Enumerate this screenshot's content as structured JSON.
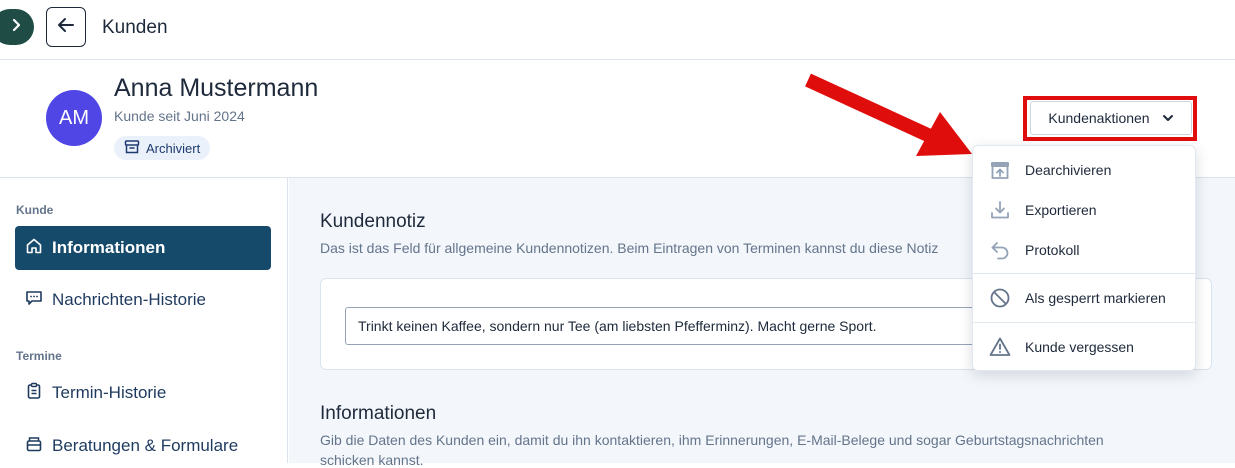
{
  "topbar": {
    "title": "Kunden",
    "expand_glyph": "›"
  },
  "customer": {
    "initials": "AM",
    "name": "Anna Mustermann",
    "since": "Kunde seit Juni 2024",
    "status_badge": "Archiviert"
  },
  "actions": {
    "button_label": "Kundenaktionen",
    "menu": [
      {
        "label": "Dearchivieren",
        "icon": "unarchive-icon"
      },
      {
        "label": "Exportieren",
        "icon": "download-icon"
      },
      {
        "label": "Protokoll",
        "icon": "undo-icon"
      },
      {
        "label": "Als gesperrt markieren",
        "icon": "block-icon"
      },
      {
        "label": "Kunde vergessen",
        "icon": "warning-icon"
      }
    ]
  },
  "sidebar": {
    "sections": [
      {
        "label": "Kunde",
        "items": [
          {
            "label": "Informationen",
            "icon": "home-icon",
            "active": true
          },
          {
            "label": "Nachrichten-Historie",
            "icon": "chat-icon"
          }
        ]
      },
      {
        "label": "Termine",
        "items": [
          {
            "label": "Termin-Historie",
            "icon": "clipboard-icon"
          },
          {
            "label": "Beratungen & Formulare",
            "icon": "forms-icon"
          }
        ]
      }
    ]
  },
  "main": {
    "note_title": "Kundennotiz",
    "note_description": "Das ist das Feld für allgemeine Kundennotizen. Beim Eintragen von Terminen kannst du diese Notiz",
    "note_value": "Trinkt keinen Kaffee, sondern nur Tee (am liebsten Pfefferminz). Macht gerne Sport.",
    "info_title": "Informationen",
    "info_description_line1": "Gib die Daten des Kunden ein, damit du ihn kontaktieren, ihm Erinnerungen, E-Mail-Belege und sogar Geburtstagsnachrichten",
    "info_description_line2": "schicken kannst."
  },
  "colors": {
    "accent_red": "#e00d0d",
    "active_nav": "#154a6b",
    "avatar": "#4f46e5",
    "expand_button": "#1f4d46"
  }
}
